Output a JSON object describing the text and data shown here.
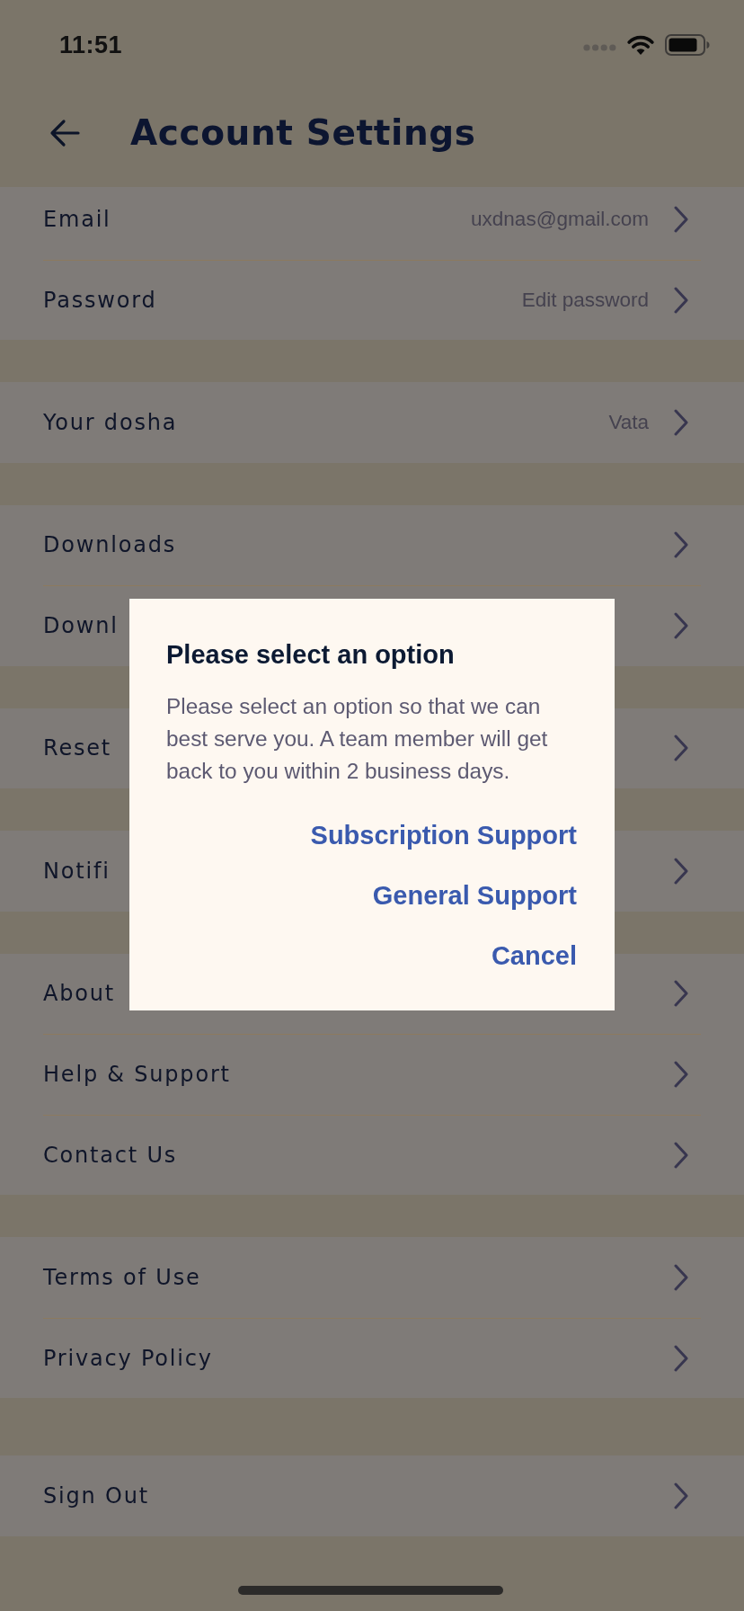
{
  "status_bar": {
    "time": "11:51"
  },
  "header": {
    "title": "Account Settings"
  },
  "groups": [
    {
      "rows": [
        {
          "label": "Email",
          "value": "uxdnas@gmail.com"
        },
        {
          "label": "Password",
          "value": "Edit password"
        }
      ]
    },
    {
      "rows": [
        {
          "label": "Your dosha",
          "value": "Vata"
        }
      ]
    },
    {
      "rows": [
        {
          "label": "Downloads"
        },
        {
          "label": "Downl"
        }
      ]
    },
    {
      "rows": [
        {
          "label": "Reset"
        }
      ]
    },
    {
      "rows": [
        {
          "label": "Notifi"
        }
      ]
    },
    {
      "rows": [
        {
          "label": "About"
        },
        {
          "label": "Help & Support"
        },
        {
          "label": "Contact Us"
        }
      ]
    },
    {
      "rows": [
        {
          "label": "Terms of Use"
        },
        {
          "label": "Privacy Policy"
        }
      ]
    },
    {
      "rows": [
        {
          "label": "Sign Out"
        }
      ]
    }
  ],
  "dialog": {
    "title": "Please select an option",
    "message": "Please select an option so that we can best serve you. A team member will get back to you within 2 business days.",
    "actions": [
      "Subscription Support",
      "General Support",
      "Cancel"
    ]
  }
}
